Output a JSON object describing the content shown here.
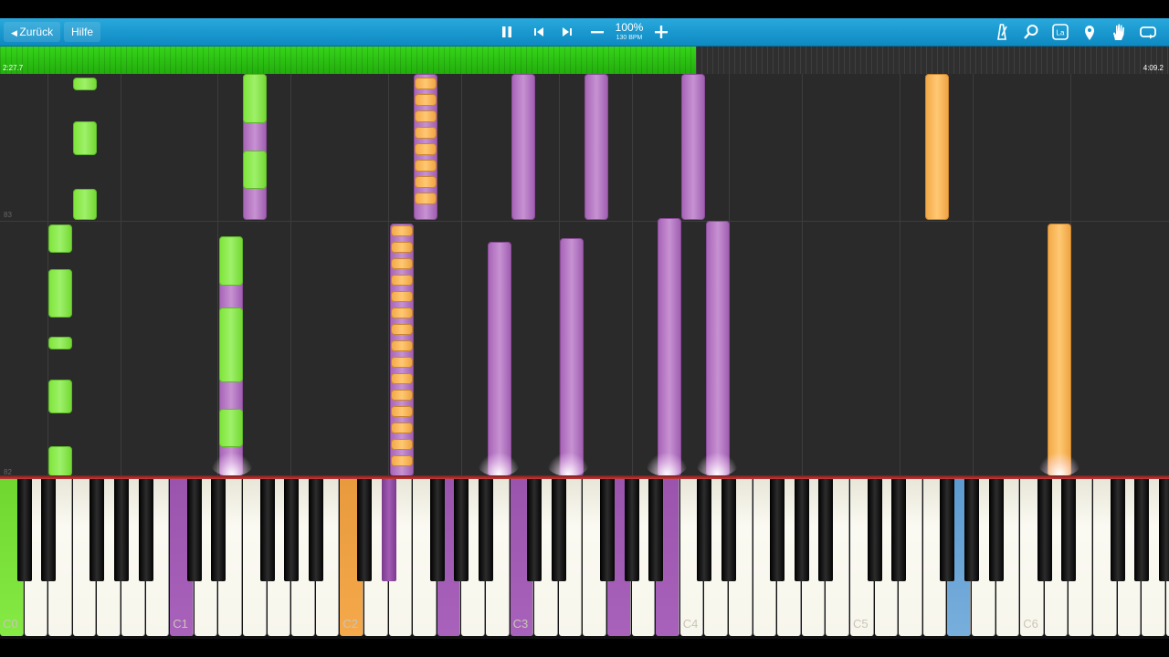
{
  "toolbar": {
    "back_label": "Zurück",
    "help_label": "Hilfe",
    "zoom": "100%",
    "bpm": "130 BPM",
    "controls": [
      "pause-icon",
      "skip-back-icon",
      "skip-forward-icon",
      "minus-icon",
      "plus-icon"
    ],
    "right_icons": [
      "metronome-icon",
      "search-icon",
      "label-icon",
      "location-pin-icon",
      "hand-icon",
      "loop-icon"
    ],
    "label_icon_text": "La"
  },
  "progress": {
    "current_time": "2:27.7",
    "total_time": "4:09.2",
    "fraction": 0.595,
    "accent": "#2ec815"
  },
  "roll": {
    "measure_labels": [
      "83",
      "82"
    ]
  },
  "keyboard": {
    "c_labels": [
      "C0",
      "C1",
      "C2",
      "C3",
      "C4",
      "C5",
      "C6"
    ],
    "pressed_keys": [
      {
        "key": "C0",
        "color": "#78dd3a"
      },
      {
        "key": "C1",
        "color": "#a25bb5"
      },
      {
        "key": "C2",
        "color": "#f0a242"
      },
      {
        "key": "D#2",
        "color": "#a25bb5"
      },
      {
        "key": "G2",
        "color": "#a25bb5"
      },
      {
        "key": "C3",
        "color": "#a25bb5"
      },
      {
        "key": "G3",
        "color": "#a25bb5"
      },
      {
        "key": "B3",
        "color": "#a25bb5"
      },
      {
        "key": "G5",
        "color": "#6ea6d6"
      }
    ]
  },
  "colors": {
    "left_hand_high": "#7fe63a",
    "left_hand_low": "#a865b8",
    "right_hand": "#f2a948",
    "toolbar": "#1a9bd2"
  }
}
